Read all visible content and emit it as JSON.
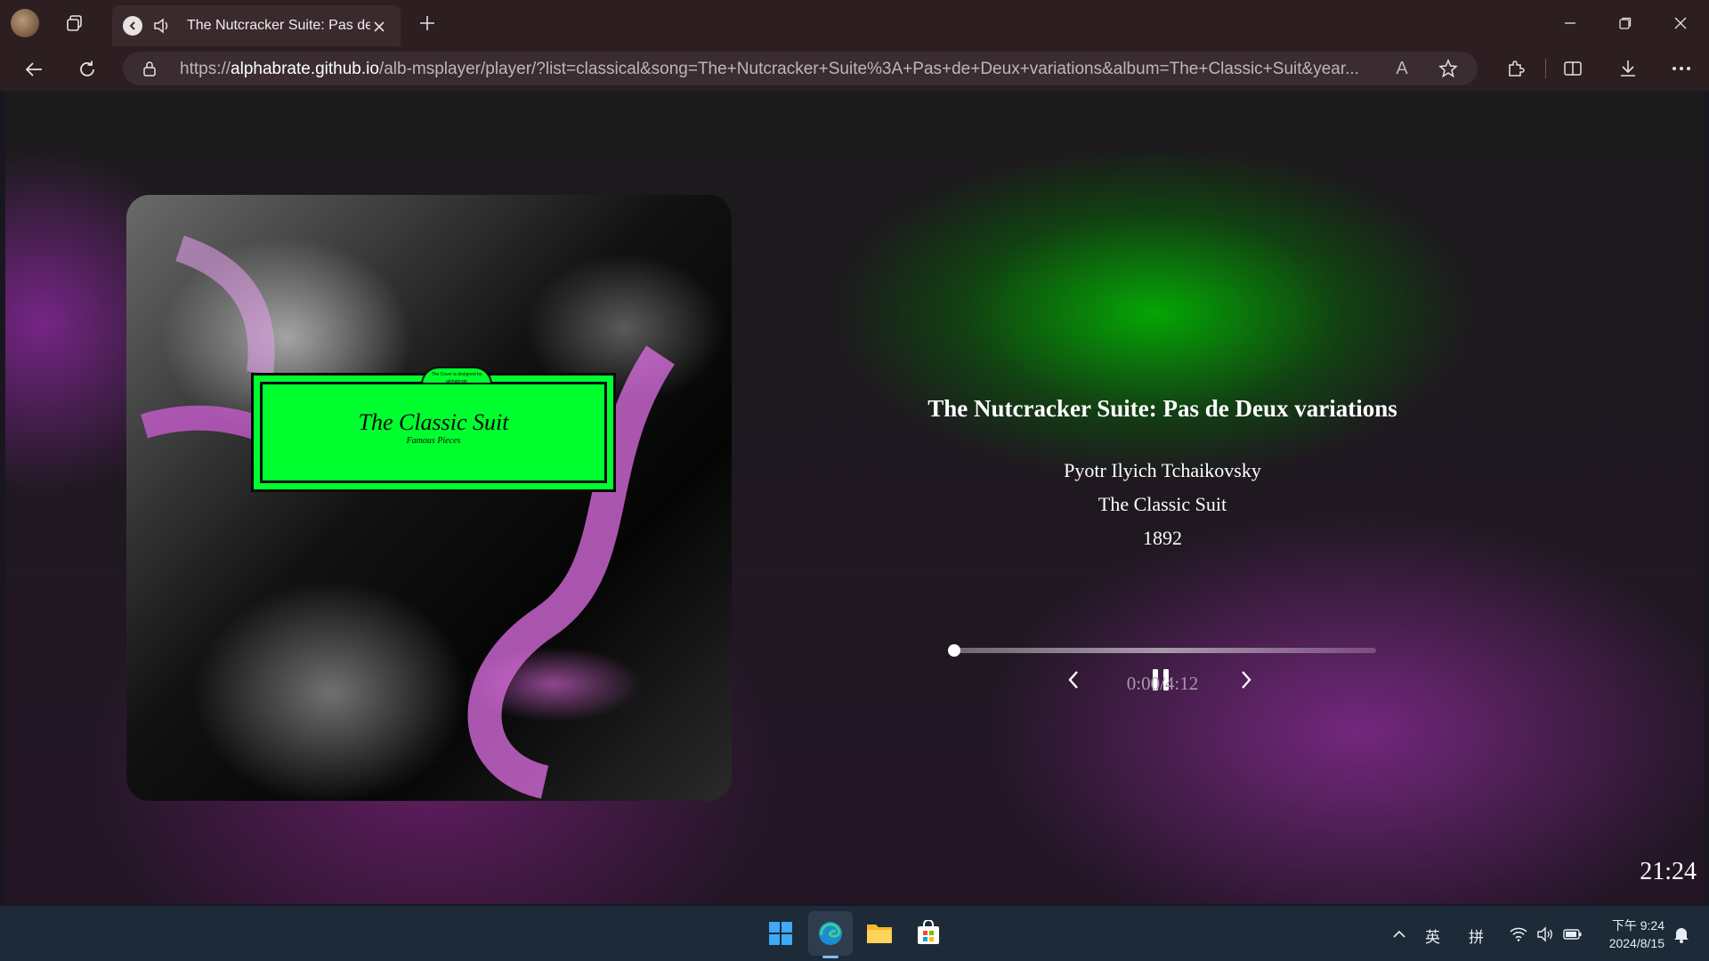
{
  "browser": {
    "tab_title": "The Nutcracker Suite: Pas de Deux variations",
    "url_scheme": "https://",
    "url_host": "alphabrate.github.io",
    "url_path": "/alb-msplayer/player/?list=classical&song=The+Nutcracker+Suite%3A+Pas+de+Deux+variations&album=The+Classic+Suit&year...",
    "read_aloud_label": "A"
  },
  "album_art": {
    "label_title": "The Classic Suit",
    "label_subtitle": "Famous Pieces",
    "label_top_text": "The Cover is designed by alphabrate"
  },
  "player": {
    "song_title": "The Nutcracker Suite: Pas de Deux variations",
    "artist": "Pyotr Ilyich Tchaikovsky",
    "album": "The Classic Suit",
    "year": "1892",
    "time_display": "0:00/4:12",
    "progress": 0,
    "clock": "21:24"
  },
  "taskbar": {
    "ime_lang": "英",
    "ime_mode": "拼",
    "tray_time": "下午 9:24",
    "tray_date": "2024/8/15"
  },
  "colors": {
    "accent_green": "#00ff2e",
    "browser_chrome": "#2c1e21",
    "taskbar": "#1d2a38"
  }
}
